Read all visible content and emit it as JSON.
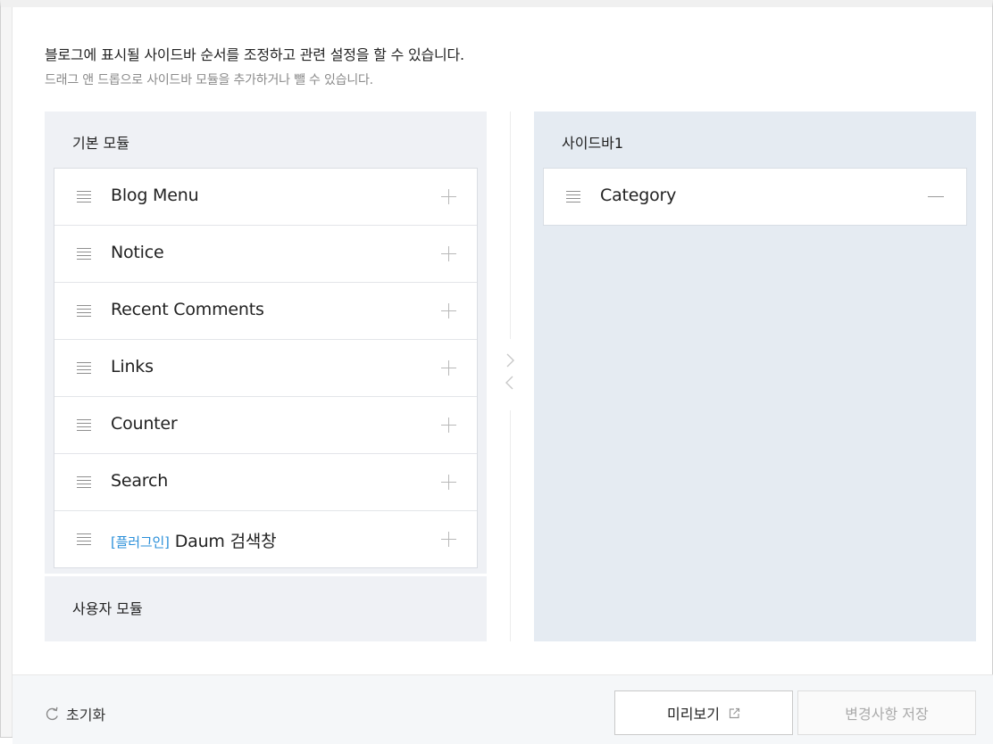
{
  "description": {
    "line1": "블로그에 표시될 사이드바 순서를 조정하고 관련 설정을 할 수 있습니다.",
    "line2": "드래그 앤 드롭으로 사이드바 모듈을 추가하거나 뺄 수 있습니다."
  },
  "basic_modules": {
    "title": "기본 모듈",
    "items": [
      {
        "label": "Blog Menu",
        "tag": ""
      },
      {
        "label": "Notice",
        "tag": ""
      },
      {
        "label": "Recent Comments",
        "tag": ""
      },
      {
        "label": "Links",
        "tag": ""
      },
      {
        "label": "Counter",
        "tag": ""
      },
      {
        "label": "Search",
        "tag": ""
      },
      {
        "label": "Daum 검색창",
        "tag": "[플러그인]"
      }
    ]
  },
  "user_modules": {
    "title": "사용자 모듈"
  },
  "sidebar1": {
    "title": "사이드바1",
    "items": [
      {
        "label": "Category"
      }
    ]
  },
  "footer": {
    "reset_label": "초기화",
    "preview_label": "미리보기",
    "save_label": "변경사항 저장"
  },
  "colors": {
    "accent_plugin": "#2a8fd9",
    "left_panel_bg": "#eff1f5",
    "right_panel_bg": "#e5ebf2"
  }
}
